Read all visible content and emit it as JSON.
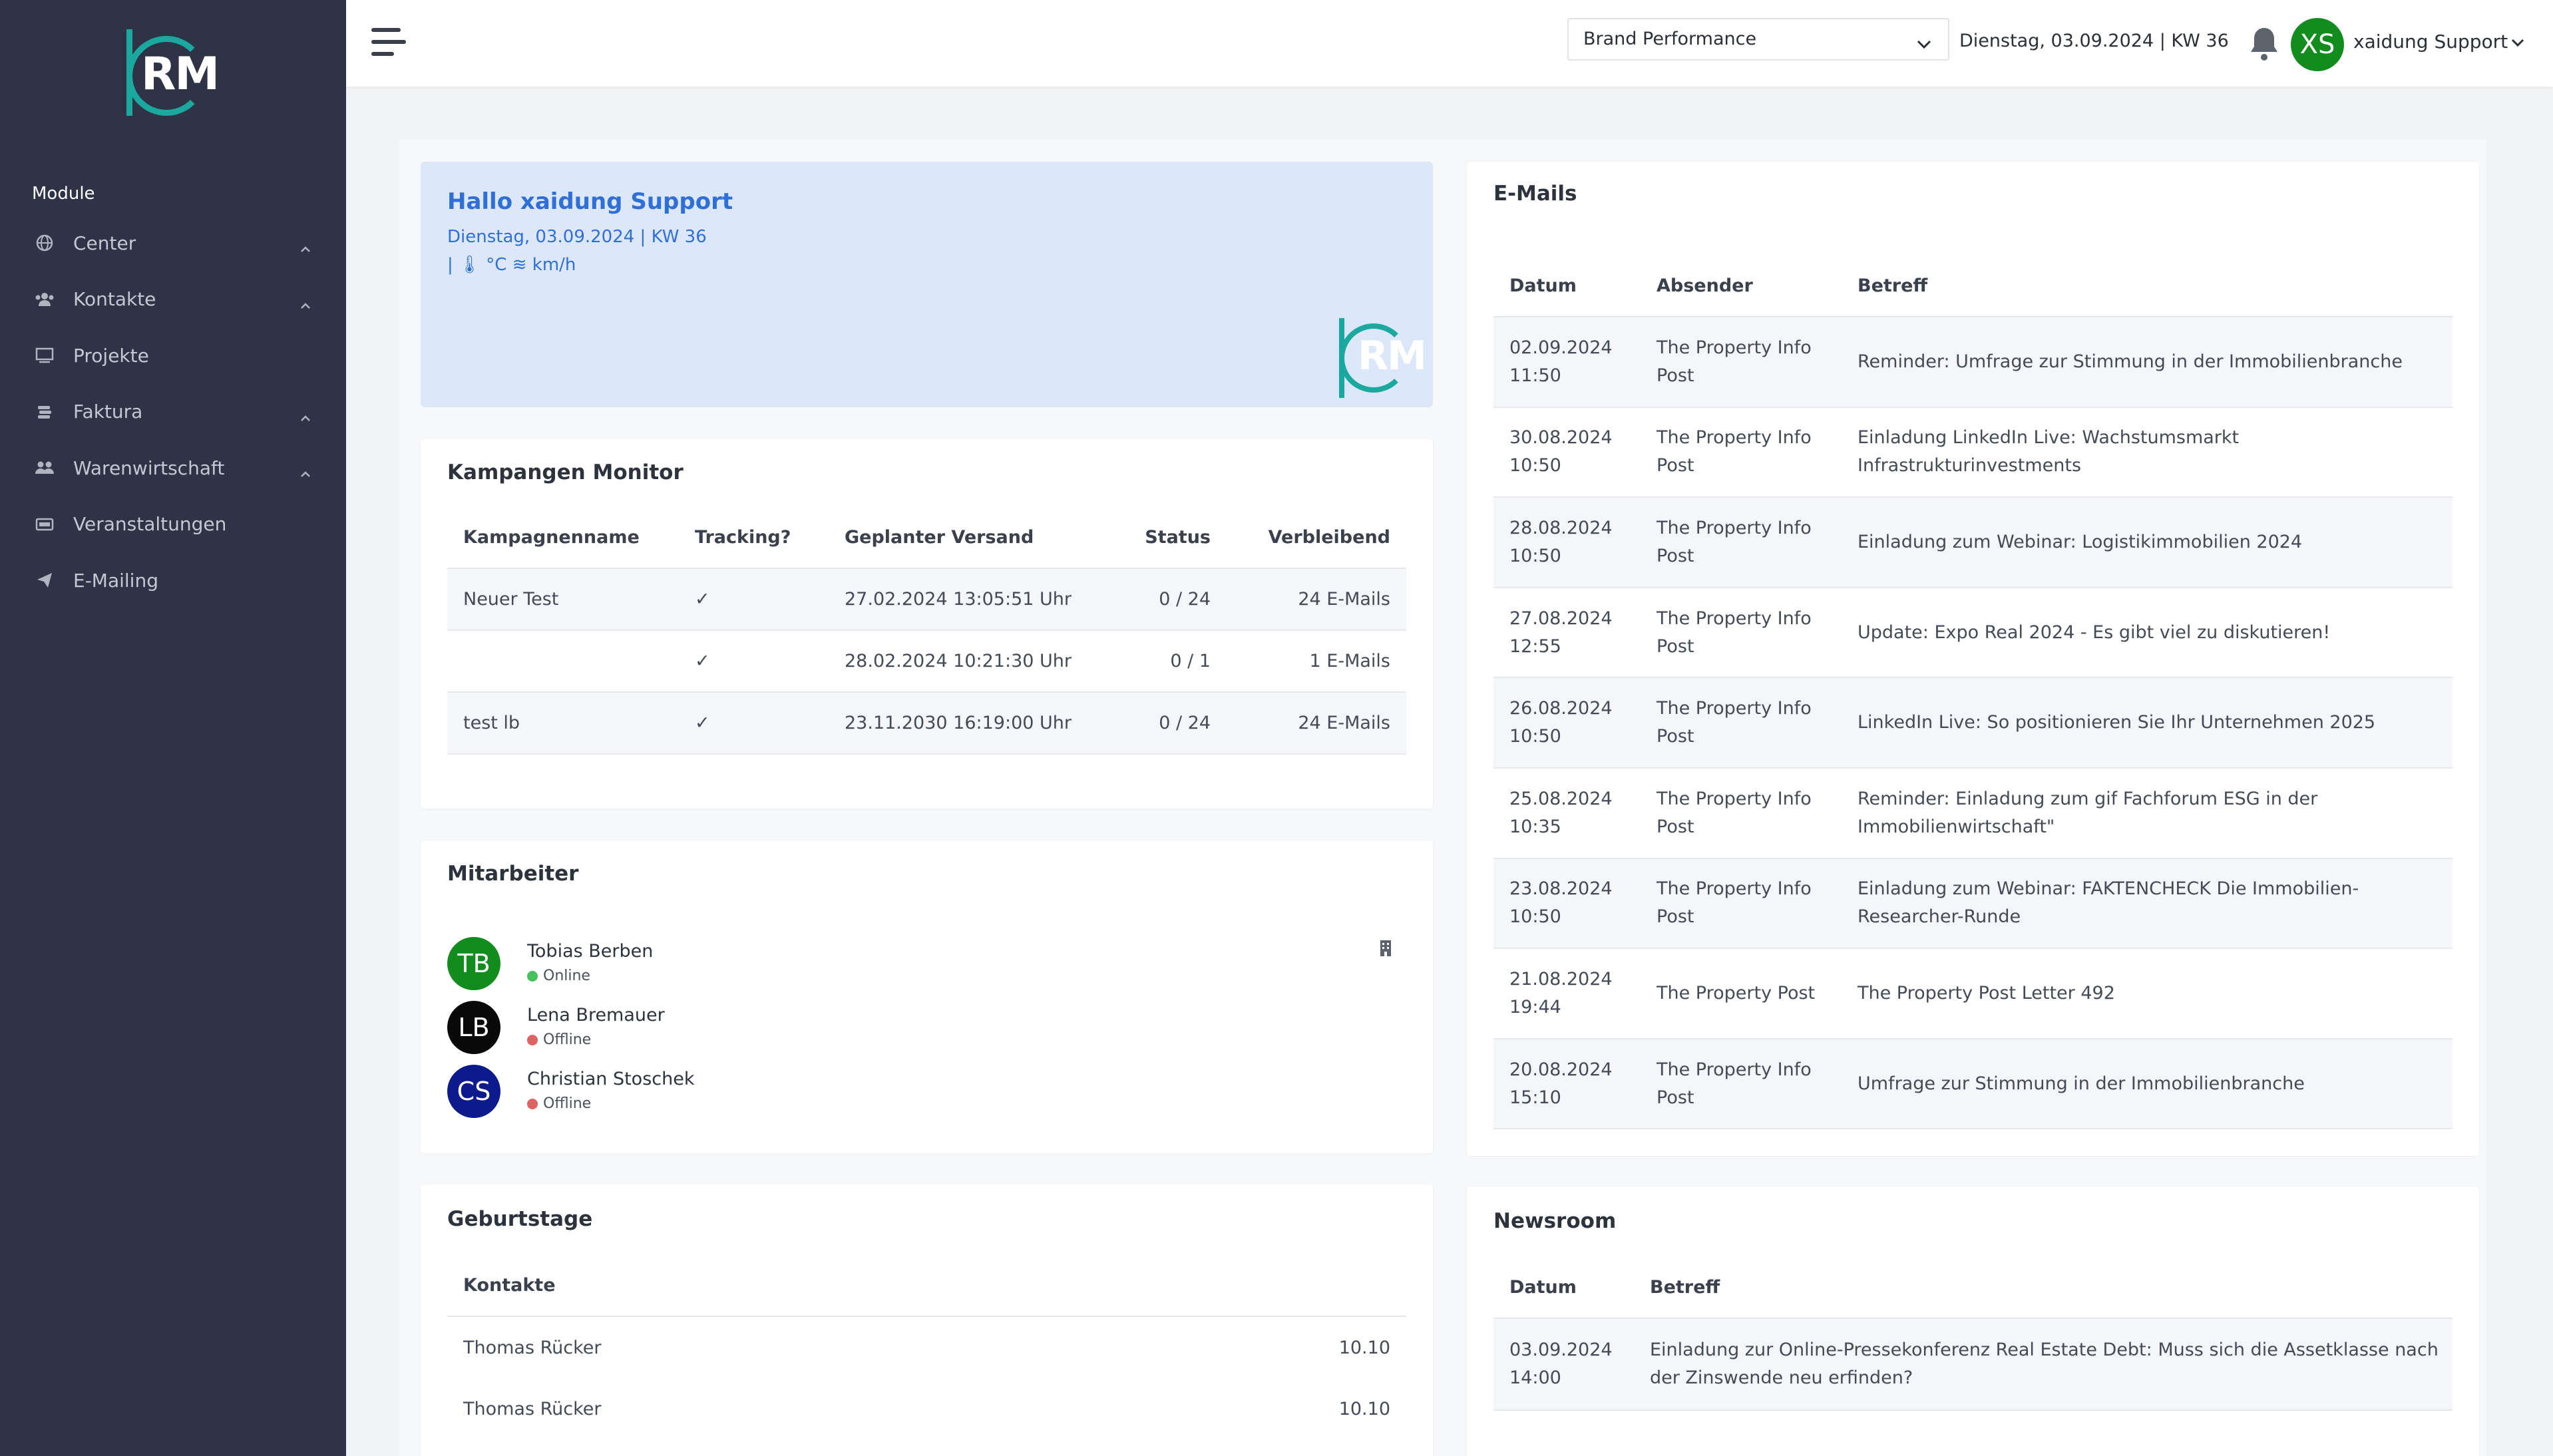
{
  "sidebar": {
    "logo_text": "RM",
    "module_label": "Module",
    "items": [
      {
        "label": "Center",
        "icon": "globe-icon",
        "expandable": true
      },
      {
        "label": "Kontakte",
        "icon": "users-icon",
        "expandable": true
      },
      {
        "label": "Projekte",
        "icon": "monitor-icon",
        "expandable": false
      },
      {
        "label": "Faktura",
        "icon": "coins-icon",
        "expandable": true
      },
      {
        "label": "Warenwirtschaft",
        "icon": "people-group-icon",
        "expandable": true
      },
      {
        "label": "Veranstaltungen",
        "icon": "ticket-icon",
        "expandable": false
      },
      {
        "label": "E-Mailing",
        "icon": "paper-plane-icon",
        "expandable": false
      }
    ]
  },
  "topbar": {
    "brand_select_value": "Brand Performance",
    "date": "Dienstag, 03.09.2024 | KW 36",
    "user_initials": "XS",
    "user_name": "xaidung Support"
  },
  "greeting": {
    "title": "Hallo xaidung Support",
    "date": "Dienstag, 03.09.2024 | KW 36",
    "weather": "|  🌡 °C ≋ km/h",
    "logo_text": "RM"
  },
  "campaigns": {
    "title": "Kampangen Monitor",
    "headers": [
      "Kampagnenname",
      "Tracking?",
      "Geplanter Versand",
      "Status",
      "Verbleibend"
    ],
    "rows": [
      {
        "name": "Neuer Test",
        "tracking": "✓",
        "date": "27.02.2024 13:05:51 Uhr",
        "status": "0 / 24",
        "remaining": "24 E-Mails"
      },
      {
        "name": "",
        "tracking": "✓",
        "date": "28.02.2024 10:21:30 Uhr",
        "status": "0 / 1",
        "remaining": "1 E-Mails"
      },
      {
        "name": "test lb",
        "tracking": "✓",
        "date": "23.11.2030 16:19:00 Uhr",
        "status": "0 / 24",
        "remaining": "24 E-Mails"
      }
    ]
  },
  "employees": {
    "title": "Mitarbeiter",
    "items": [
      {
        "initials": "TB",
        "name": "Tobias Berben",
        "status": "Online",
        "avatar_color": "#128c1d",
        "dot_color": "#47c25a"
      },
      {
        "initials": "LB",
        "name": "Lena Bremauer",
        "status": "Offline",
        "avatar_color": "#0a0a0a",
        "dot_color": "#e26363"
      },
      {
        "initials": "CS",
        "name": "Christian Stoschek",
        "status": "Offline",
        "avatar_color": "#0c1a8c",
        "dot_color": "#e26363"
      }
    ]
  },
  "birthdays": {
    "title": "Geburtstage",
    "header": "Kontakte",
    "rows": [
      {
        "name": "Thomas Rücker",
        "date": "10.10"
      },
      {
        "name": "Thomas Rücker",
        "date": "10.10"
      }
    ]
  },
  "emails": {
    "title": "E-Mails",
    "headers": [
      "Datum",
      "Absender",
      "Betreff"
    ],
    "rows": [
      {
        "date": "02.09.2024",
        "time": "11:50",
        "sender1": "The Property Info",
        "sender2": "Post",
        "subject1": "Reminder: Umfrage zur Stimmung in der Immobilienbranche",
        "subject2": ""
      },
      {
        "date": "30.08.2024",
        "time": "10:50",
        "sender1": "The Property Info",
        "sender2": "Post",
        "subject1": "Einladung LinkedIn Live: Wachstumsmarkt",
        "subject2": "Infrastrukturinvestments"
      },
      {
        "date": "28.08.2024",
        "time": "10:50",
        "sender1": "The Property Info",
        "sender2": "Post",
        "subject1": "Einladung zum Webinar: Logistikimmobilien 2024",
        "subject2": ""
      },
      {
        "date": "27.08.2024",
        "time": "12:55",
        "sender1": "The Property Info",
        "sender2": "Post",
        "subject1": "Update: Expo Real 2024 - Es gibt viel zu diskutieren!",
        "subject2": ""
      },
      {
        "date": "26.08.2024",
        "time": "10:50",
        "sender1": "The Property Info",
        "sender2": "Post",
        "subject1": "LinkedIn Live: So positionieren Sie Ihr Unternehmen 2025",
        "subject2": ""
      },
      {
        "date": "25.08.2024",
        "time": "10:35",
        "sender1": "The Property Info",
        "sender2": "Post",
        "subject1": "Reminder: Einladung zum gif Fachforum ESG in der",
        "subject2": "Immobilienwirtschaft\""
      },
      {
        "date": "23.08.2024",
        "time": "10:50",
        "sender1": "The Property Info",
        "sender2": "Post",
        "subject1": "Einladung zum Webinar: FAKTENCHECK  Die Immobilien-",
        "subject2": "Researcher-Runde"
      },
      {
        "date": "21.08.2024",
        "time": "19:44",
        "sender1": "The Property Post",
        "sender2": "",
        "subject1": "The Property Post Letter 492",
        "subject2": ""
      },
      {
        "date": "20.08.2024",
        "time": "15:10",
        "sender1": "The Property Info",
        "sender2": "Post",
        "subject1": "Umfrage zur Stimmung in der Immobilienbranche",
        "subject2": ""
      }
    ]
  },
  "newsroom": {
    "title": "Newsroom",
    "headers": [
      "Datum",
      "Betreff"
    ],
    "rows": [
      {
        "date": "03.09.2024",
        "time": "14:00",
        "subject1": "Einladung zur Online-Pressekonferenz Real Estate Debt: Muss sich die Assetklasse nach",
        "subject2": "der Zinswende neu erfinden?"
      }
    ]
  }
}
